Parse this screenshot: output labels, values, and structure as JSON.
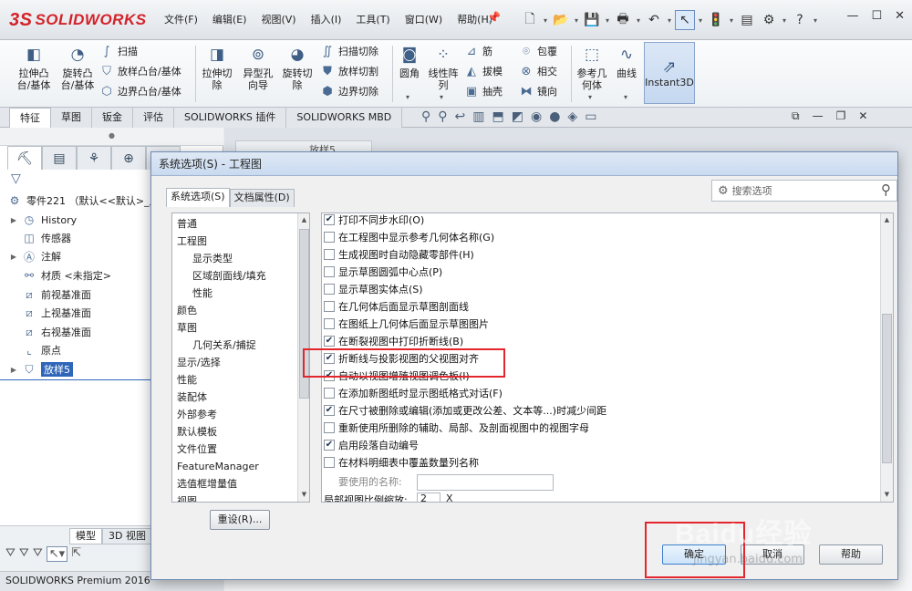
{
  "app": {
    "logo": "SOLIDWORKS",
    "logo_mark": "3S",
    "accent": "#d3232a",
    "menu": [
      "文件(F)",
      "编辑(E)",
      "视图(V)",
      "插入(I)",
      "工具(T)",
      "窗口(W)",
      "帮助(H)"
    ]
  },
  "ribbon": {
    "extrude_boss": "拉伸凸\n台/基体",
    "revolve_boss": "旋转凸\n台/基体",
    "sweep": "扫描",
    "loft_boss": "放样凸台/基体",
    "boundary_boss": "边界凸台/基体",
    "extrude_cut": "拉伸切\n除",
    "hole_wizard": "异型孔\n向导",
    "revolve_cut": "旋转切\n除",
    "swept_cut": "扫描切除",
    "lofted_cut": "放样切割",
    "boundary_cut": "边界切除",
    "fillet": "圆角",
    "linear_pattern": "线性阵\n列",
    "rib": "筋",
    "draft": "拔模",
    "shell": "抽壳",
    "wrap": "包覆",
    "intersect": "相交",
    "mirror": "镜向",
    "ref_geometry": "参考几\n何体",
    "curves": "曲线",
    "instant3d": "Instant3D"
  },
  "tabs": [
    "特征",
    "草图",
    "钣金",
    "评估",
    "SOLIDWORKS 插件",
    "SOLIDWORKS MBD"
  ],
  "tree": {
    "part": "零件221 （默认<<默认>_显",
    "items": [
      "History",
      "传感器",
      "注解",
      "材质 <未指定>",
      "前视基准面",
      "上视基准面",
      "右视基准面",
      "原点",
      "放样5"
    ]
  },
  "bottom_tabs": [
    "模型",
    "3D 视图"
  ],
  "status": "SOLIDWORKS Premium 2016",
  "graphics_tab": "放样5",
  "dialog": {
    "title": "系统选项(S) - 工程图",
    "tabs": [
      "系统选项(S)",
      "文档属性(D)"
    ],
    "search_placeholder": "搜索选项",
    "nav": [
      "普通",
      "工程图",
      "显示类型",
      "区域剖面线/填充",
      "性能",
      "颜色",
      "草图",
      "几何关系/捕捉",
      "显示/选择",
      "性能",
      "装配体",
      "外部参考",
      "默认模板",
      "文件位置",
      "FeatureManager",
      "选值框增量值",
      "视图"
    ],
    "options": [
      {
        "label": "打印不同步水印(O)",
        "checked": true
      },
      {
        "label": "在工程图中显示参考几何体名称(G)",
        "checked": false
      },
      {
        "label": "生成视图时自动隐藏零部件(H)",
        "checked": false
      },
      {
        "label": "显示草图圆弧中心点(P)",
        "checked": false
      },
      {
        "label": "显示草图实体点(S)",
        "checked": false
      },
      {
        "label": "在几何体后面显示草图剖面线",
        "checked": false
      },
      {
        "label": "在图纸上几何体后面显示草图图片",
        "checked": false
      },
      {
        "label": "在断裂视图中打印折断线(B)",
        "checked": true
      },
      {
        "label": "折断线与投影视图的父视图对齐",
        "checked": true
      },
      {
        "label": "自动以视图增殖视图调色板(I)",
        "checked": true
      },
      {
        "label": "在添加新图纸时显示图纸格式对话(F)",
        "checked": false
      },
      {
        "label": "在尺寸被删除或编辑(添加或更改公差、文本等...)时减少间距",
        "checked": true
      },
      {
        "label": "重新使用所删除的辅助、局部、及剖面视图中的视图字母",
        "checked": false
      },
      {
        "label": "启用段落自动编号",
        "checked": true
      },
      {
        "label": "在材料明细表中覆盖数量列名称",
        "checked": false
      }
    ],
    "name_label": "要使用的名称:",
    "scale_label": "局部视图比例缩放:",
    "scale_value": "2",
    "scale_unit": "X",
    "reset": "重设(R)...",
    "ok": "确定",
    "cancel": "取消",
    "help": "帮助"
  },
  "highlight_color": "#e3262d",
  "watermark": "Baidu经验",
  "watermark_url": "jingyan.baidu.com"
}
